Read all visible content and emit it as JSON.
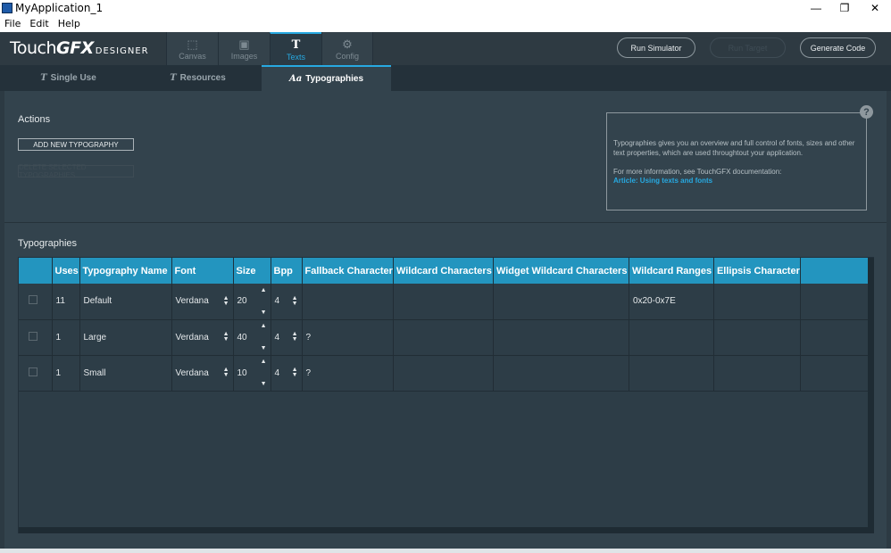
{
  "window": {
    "title": "MyApplication_1",
    "minimize": "—",
    "restore": "❐",
    "close": "✕"
  },
  "menu": [
    "File",
    "Edit",
    "Help"
  ],
  "logo": {
    "touch": "Touch",
    "gfx": "GFX",
    "designer": "DESIGNER"
  },
  "nav_tabs": [
    {
      "label": "Canvas",
      "icon": "canvas-icon",
      "glyph": "⬚"
    },
    {
      "label": "Images",
      "icon": "image-icon",
      "glyph": "▣"
    },
    {
      "label": "Texts",
      "icon": "text-t-icon",
      "glyph": "T"
    },
    {
      "label": "Config",
      "icon": "gear-icon",
      "glyph": "⚙"
    }
  ],
  "header_buttons": {
    "run_simulator": "Run Simulator",
    "run_target": "Run Target",
    "generate_code": "Generate Code"
  },
  "sub_tabs": [
    {
      "label": "Single Use",
      "glyph": "T"
    },
    {
      "label": "Resources",
      "glyph": "T"
    },
    {
      "label": "Typographies",
      "glyph": "Aa"
    }
  ],
  "actions": {
    "title": "Actions",
    "add_label": "ADD NEW TYPOGRAPHY",
    "delete_label": "DELETE SELECTED TYPOGRAPHIES"
  },
  "info": {
    "line1": "Typographies gives you an overview and full control of fonts, sizes and other text properties, which are used throughtout your application.",
    "line2": "For more information, see TouchGFX documentation:",
    "link": "Article: Using texts and fonts",
    "help": "?"
  },
  "table": {
    "title": "Typographies",
    "headers": [
      "",
      "Uses",
      "Typography Name",
      "Font",
      "Size",
      "Bpp",
      "Fallback Character",
      "Wildcard Characters",
      "Widget Wildcard Characters",
      "Wildcard Ranges",
      "Ellipsis Character",
      ""
    ],
    "rows": [
      {
        "uses": "11",
        "name": "Default",
        "font": "Verdana",
        "size": "20",
        "bpp": "4",
        "fallback": "",
        "wildcard": "",
        "widget_wildcard": "",
        "ranges": "0x20-0x7E",
        "ellipsis": ""
      },
      {
        "uses": "1",
        "name": "Large",
        "font": "Verdana",
        "size": "40",
        "bpp": "4",
        "fallback": "?",
        "wildcard": "",
        "widget_wildcard": "",
        "ranges": "",
        "ellipsis": ""
      },
      {
        "uses": "1",
        "name": "Small",
        "font": "Verdana",
        "size": "10",
        "bpp": "4",
        "fallback": "?",
        "wildcard": "",
        "widget_wildcard": "",
        "ranges": "",
        "ellipsis": ""
      }
    ]
  },
  "colors": {
    "accent": "#27a9e1",
    "header_row": "#2395bf",
    "panel": "#33434d"
  }
}
